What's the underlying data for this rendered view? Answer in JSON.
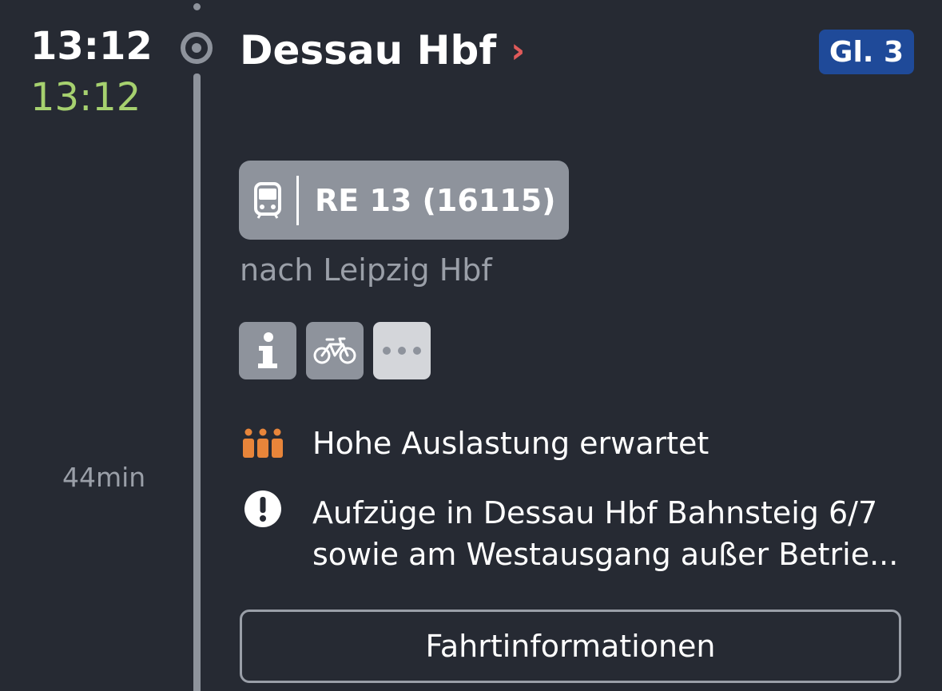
{
  "stop": {
    "planned_time": "13:12",
    "actual_time": "13:12",
    "station_name": "Dessau Hbf",
    "chevron": "›",
    "platform": "Gl. 3"
  },
  "train": {
    "label": "RE 13 (16115)",
    "direction": "nach Leipzig Hbf"
  },
  "attributes": [
    "info-icon",
    "bicycle-icon",
    "more-icon"
  ],
  "messages": {
    "occupancy": "Hohe Auslastung erwartet",
    "warning_line1": "Aufzüge in Dessau Hbf Bahnsteig 6/7",
    "warning_line2": "sowie am Westausgang außer Betrie..."
  },
  "segment": {
    "duration": "44min"
  },
  "button": {
    "label": "Fahrtinformationen"
  },
  "colors": {
    "background": "#262a33",
    "actual_time": "#a6d16f",
    "platform_badge": "#1f4a99",
    "chevron": "#e05a5a",
    "occupancy_icon": "#e8853a",
    "chip": "#8e939c"
  }
}
